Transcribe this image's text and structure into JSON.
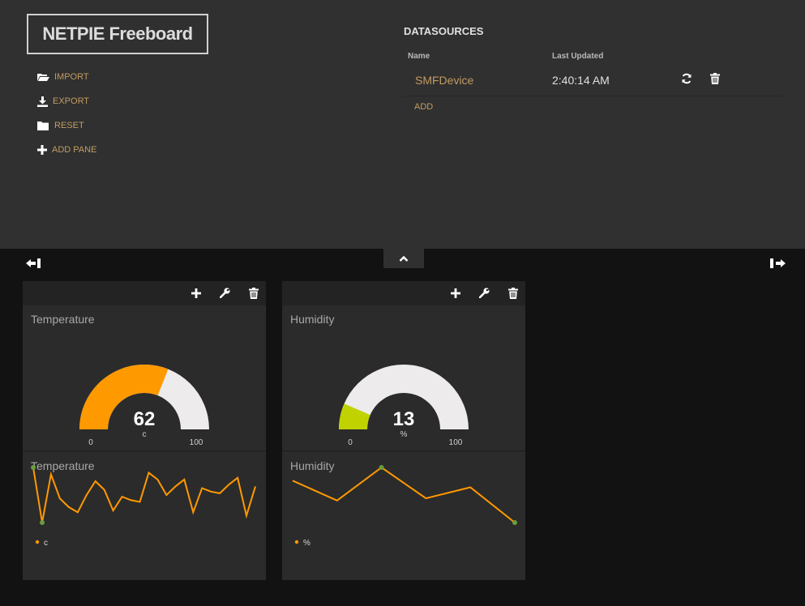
{
  "header": {
    "title": "NETPIE Freeboard",
    "menu": [
      {
        "label": "IMPORT",
        "icon": "folder-open-icon"
      },
      {
        "label": "EXPORT",
        "icon": "download-icon"
      },
      {
        "label": "RESET",
        "icon": "folder-icon"
      },
      {
        "label": "ADD PANE",
        "icon": "plus-icon"
      }
    ]
  },
  "datasources": {
    "title": "DATASOURCES",
    "col_name": "Name",
    "col_updated": "Last Updated",
    "rows": [
      {
        "name": "SMFDevice",
        "last_updated": "2:40:14 AM"
      }
    ],
    "add_label": "ADD"
  },
  "panes": [
    {
      "gauge": {
        "title": "Temperature",
        "value": 62,
        "value_label": "62",
        "units": "c",
        "min": 0,
        "max": 100,
        "min_label": "0",
        "max_label": "100",
        "color": "#ff9900"
      },
      "sparkline": {
        "title": "Temperature",
        "legend": "c",
        "values": [
          62,
          30,
          58,
          44,
          39,
          36,
          46,
          54,
          49,
          37,
          45,
          43,
          42,
          59,
          55,
          46,
          51,
          55,
          36,
          50,
          48,
          47,
          52,
          56,
          34,
          51
        ]
      }
    },
    {
      "gauge": {
        "title": "Humidity",
        "value": 13,
        "value_label": "13",
        "units": "%",
        "min": 0,
        "max": 100,
        "min_label": "0",
        "max_label": "100",
        "color": "#c0d300"
      },
      "sparkline": {
        "title": "Humidity",
        "legend": "%",
        "values": [
          58,
          49,
          64,
          50,
          55,
          39
        ]
      }
    }
  ],
  "colors": {
    "accent": "#c29b62",
    "line": "#ff9900",
    "minmax_point": "#6b9c3e",
    "gauge_track": "#edebeb"
  }
}
